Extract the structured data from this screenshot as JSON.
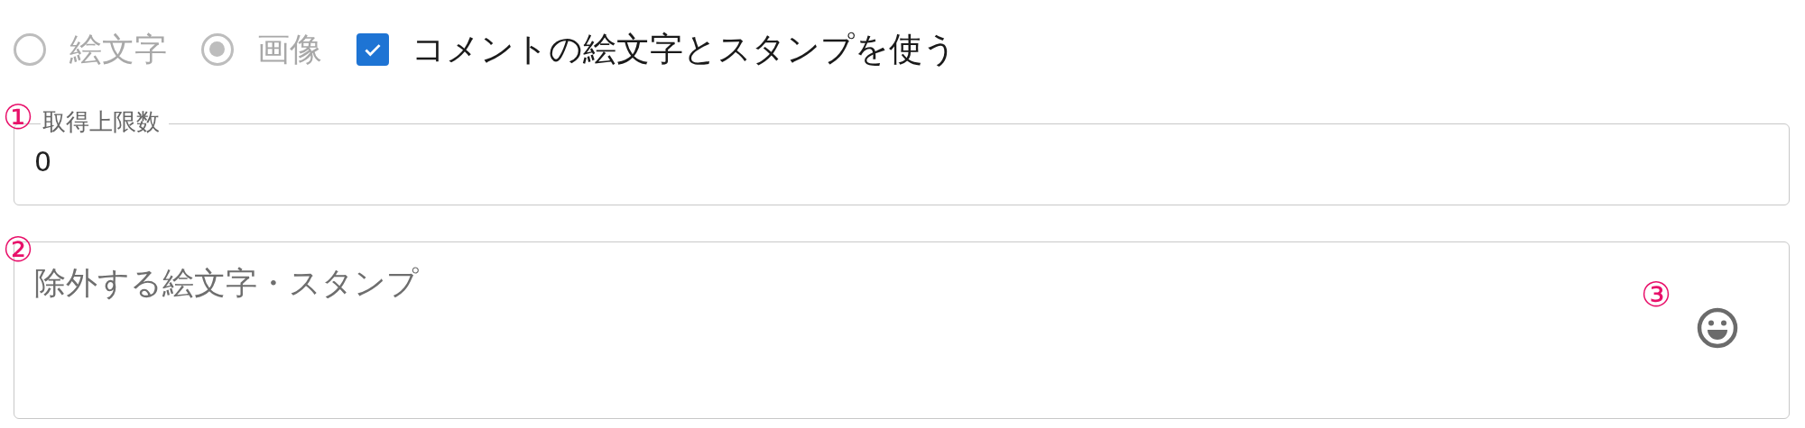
{
  "radios": [
    {
      "label": "絵文字",
      "selected": false,
      "disabled": true
    },
    {
      "label": "画像",
      "selected": true,
      "disabled": true
    }
  ],
  "checkbox": {
    "label": "コメントの絵文字とスタンプを使う",
    "checked": true
  },
  "limit_field": {
    "label": "取得上限数",
    "value": "0",
    "marker": "①"
  },
  "exclude_field": {
    "placeholder": "除外する絵文字・スタンプ",
    "marker": "②",
    "emoji_marker": "③"
  }
}
